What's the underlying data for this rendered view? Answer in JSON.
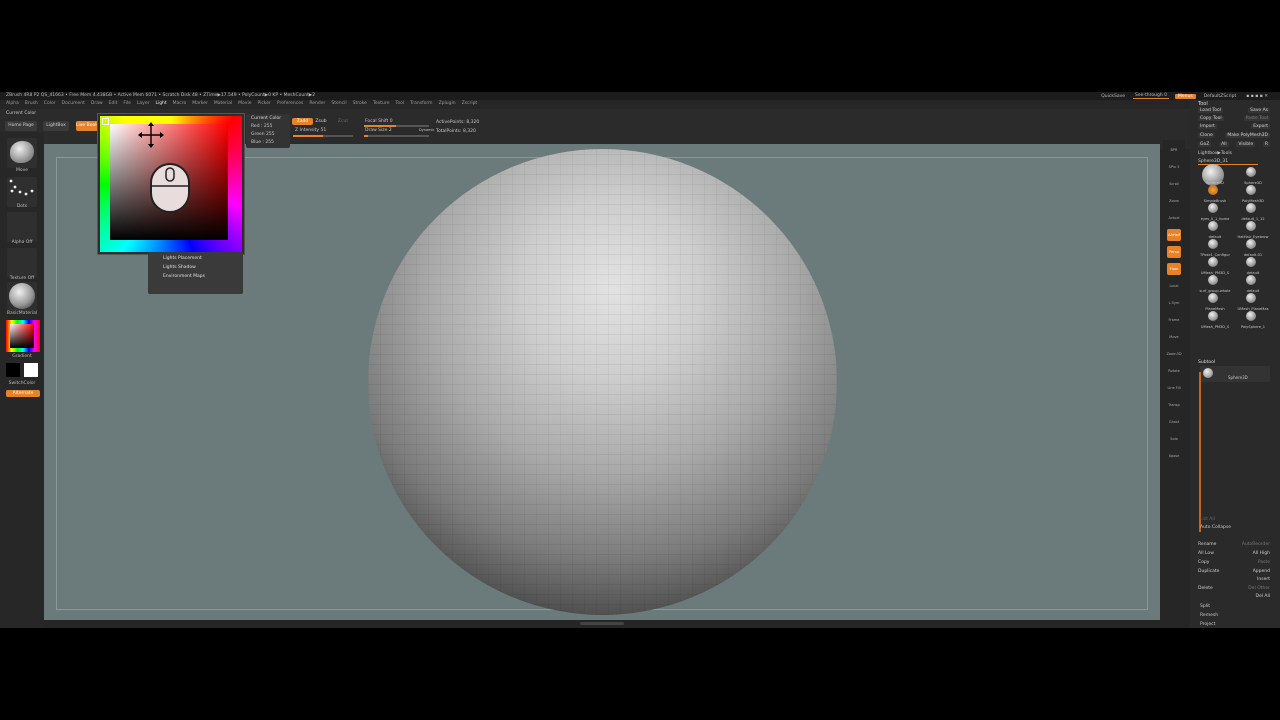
{
  "titlebar": {
    "title": "ZBrush 4R8 P2    QS_41663  • Free Mem 4.438GB • Active Mem 6071 • Scratch Disk 48 • ZTime▶17.549 • PolyCount▶0 KP • MeshCount▶2",
    "quicksave": "QuickSave",
    "see_through": "See-through  0",
    "menus_btn": "Menus",
    "default_script": "DefaultZScript"
  },
  "menubar": [
    "Alpha",
    "Brush",
    "Color",
    "Document",
    "Draw",
    "Edit",
    "File",
    "Layer",
    "Light",
    "Macro",
    "Marker",
    "Material",
    "Movie",
    "Picker",
    "Preferences",
    "Render",
    "Stencil",
    "Stroke",
    "Texture",
    "Tool",
    "Transform",
    "Zplugin",
    "Zscript"
  ],
  "menubar_active": "Light",
  "shelf": {
    "current_color": "Current Color",
    "home_page": "Home Page",
    "lightbox": "LightBox",
    "live_boolean": "Live Boolean",
    "zadd": "Zadd",
    "zsub": "Zsub",
    "zcut": "Zcut",
    "z_intensity": "Z Intensity 51",
    "focal_shift": "Focal Shift 0",
    "draw_size": "Draw Size 2",
    "dynamic": "Dynamic",
    "active_points": "ActivePoints: 8,320",
    "total_points": "TotalPoints: 8,320",
    "cc_title": "Current Color",
    "cc_red": "Red : 255",
    "cc_green": "Green 255",
    "cc_blue": "Blue : 255"
  },
  "light_menu": [
    "Lights Placement",
    "Lights Shadow",
    "Environment Maps"
  ],
  "leftbar": {
    "brush_label": "Move",
    "stroke_label": "Dots",
    "alpha_label": "Alpha Off",
    "texture_label": "Texture Off",
    "material_label": "BasicMaterial",
    "gradient_label": "Gradient",
    "switch_color": "SwitchColor",
    "alternate": "Alternate"
  },
  "vtoolbar": [
    "BPR",
    "SPix 3",
    "Scroll",
    "Zoom",
    "Actual",
    "AAHalf",
    "Persp",
    "Floor",
    "Local",
    "L.Sym",
    "Frame",
    "Move",
    "Zoom3D",
    "Rotate",
    "Line Fill",
    "Transp",
    "Ghost",
    "Solo",
    "Xpose"
  ],
  "tool_panel": {
    "title": "Tool",
    "load_tool": "Load Tool",
    "save_as": "Save As",
    "copy_tool": "Copy Tool",
    "paste_tool": "Paste Tool",
    "import": "Import",
    "export": "Export",
    "clone": "Clone",
    "make_polymesh": "Make PolyMesh3D",
    "goz": "GoZ",
    "all": "All",
    "visible": "Visible",
    "r": "R",
    "lightbox_tools": "Lightbox▶Tools",
    "current_tool": "Sphere3D_31",
    "tools": [
      "Sphere3D",
      "Sphere3D",
      "SimpleBrush",
      "PolyMesh3D",
      "eyes_0_1_home",
      "default_1_12",
      "default",
      "HatHair_Eyebrow",
      "TPose1_Configur",
      "default.01",
      "UMesh_PM3D_S",
      "default",
      "surf_group.whole",
      "default",
      "PlaneMesh",
      "UMesh_PlaneMas",
      "UMesh_PM3D_S",
      "PolySphere_1"
    ],
    "subtool_title": "Subtool",
    "subtool_name": "Sphere3D",
    "list_all": "List All",
    "auto_collapse": "Auto Collapse",
    "rename": "Rename",
    "auto_reorder": "AutoReorder",
    "all_low": "All Low",
    "all_high": "All High",
    "copy": "Copy",
    "paste": "Paste",
    "duplicate": "Duplicate",
    "append": "Append",
    "insert": "Insert",
    "del_other": "Del Other",
    "delete": "Delete",
    "del_all": "Del All",
    "split": "Split",
    "remesh": "Remesh",
    "project": "Project"
  },
  "colors": {
    "accent": "#e8822a",
    "viewport": "#6b7b7b",
    "panel": "#262626"
  }
}
